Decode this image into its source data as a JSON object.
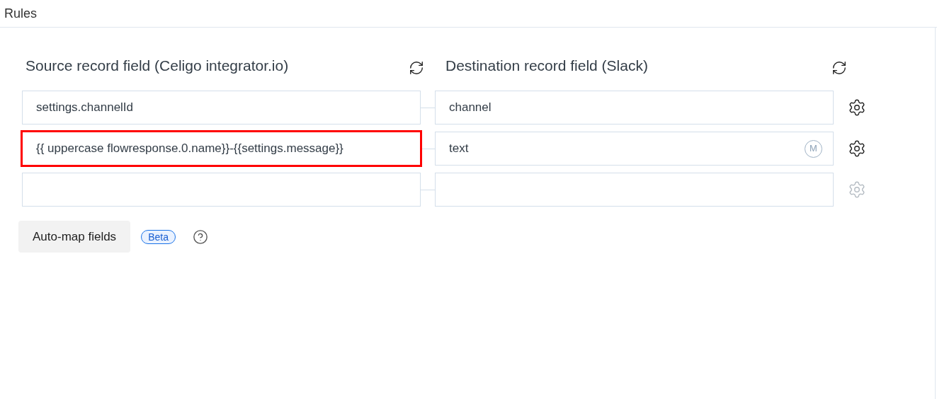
{
  "panel": {
    "title": "Rules"
  },
  "source_heading": "Source record field (Celigo integrator.io)",
  "destination_heading": "Destination record field (Slack)",
  "mappings": [
    {
      "source": "settings.channelId",
      "destination": "channel",
      "highlighted": false,
      "settings_disabled": false
    },
    {
      "source": "{{ uppercase flowresponse.0.name}}-{{settings.message}}",
      "destination": "text",
      "badge": "M",
      "highlighted": true,
      "settings_disabled": false
    },
    {
      "highlighted": false,
      "settings_disabled": true
    }
  ],
  "auto_map_button": "Auto-map fields",
  "beta_badge": "Beta"
}
